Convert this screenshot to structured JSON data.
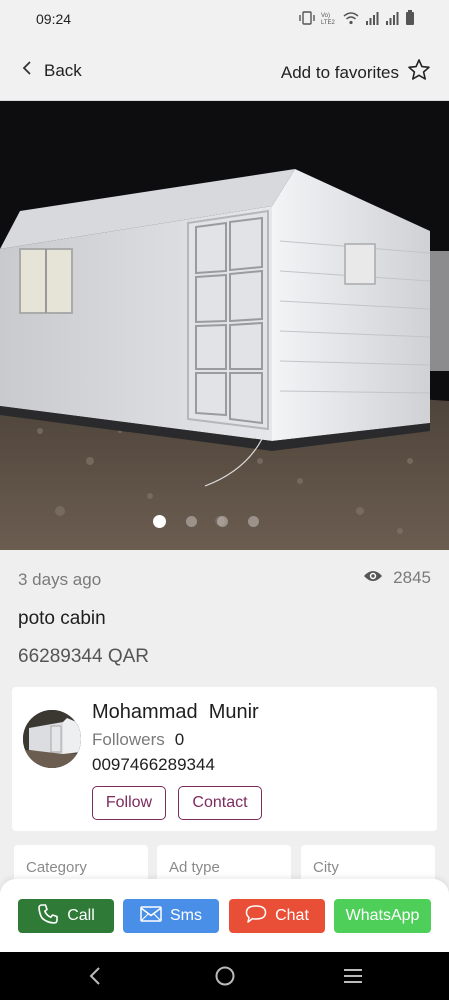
{
  "status_bar": {
    "time": "09:24",
    "icons": [
      "vibrate-icon",
      "volte-icon",
      "wifi-icon",
      "signal-icon",
      "signal-icon",
      "battery-icon"
    ],
    "volte_text": "Vo) LTE2"
  },
  "app_bar": {
    "back_label": "Back",
    "favorites_label": "Add to favorites"
  },
  "gallery": {
    "image_count": 4,
    "active_index": 0
  },
  "ad": {
    "posted": "3 days ago",
    "views": "2845",
    "title": "poto cabin",
    "price": "66289344 QAR"
  },
  "seller": {
    "name": "Mohammad  Munir",
    "followers_label": "Followers",
    "followers_count": "0",
    "phone": "0097466289344",
    "follow_label": "Follow",
    "contact_label": "Contact"
  },
  "info_cards": [
    {
      "label": "Category"
    },
    {
      "label": "Ad type"
    },
    {
      "label": "City"
    }
  ],
  "actions": {
    "call_label": "Call",
    "sms_label": "Sms",
    "chat_label": "Chat",
    "whatsapp_label": "WhatsApp"
  },
  "colors": {
    "brand": "#7d2b5d",
    "call": "#2f7a37",
    "sms": "#4a8fe7",
    "chat": "#e94f36",
    "whatsapp": "#4ecf5a"
  }
}
